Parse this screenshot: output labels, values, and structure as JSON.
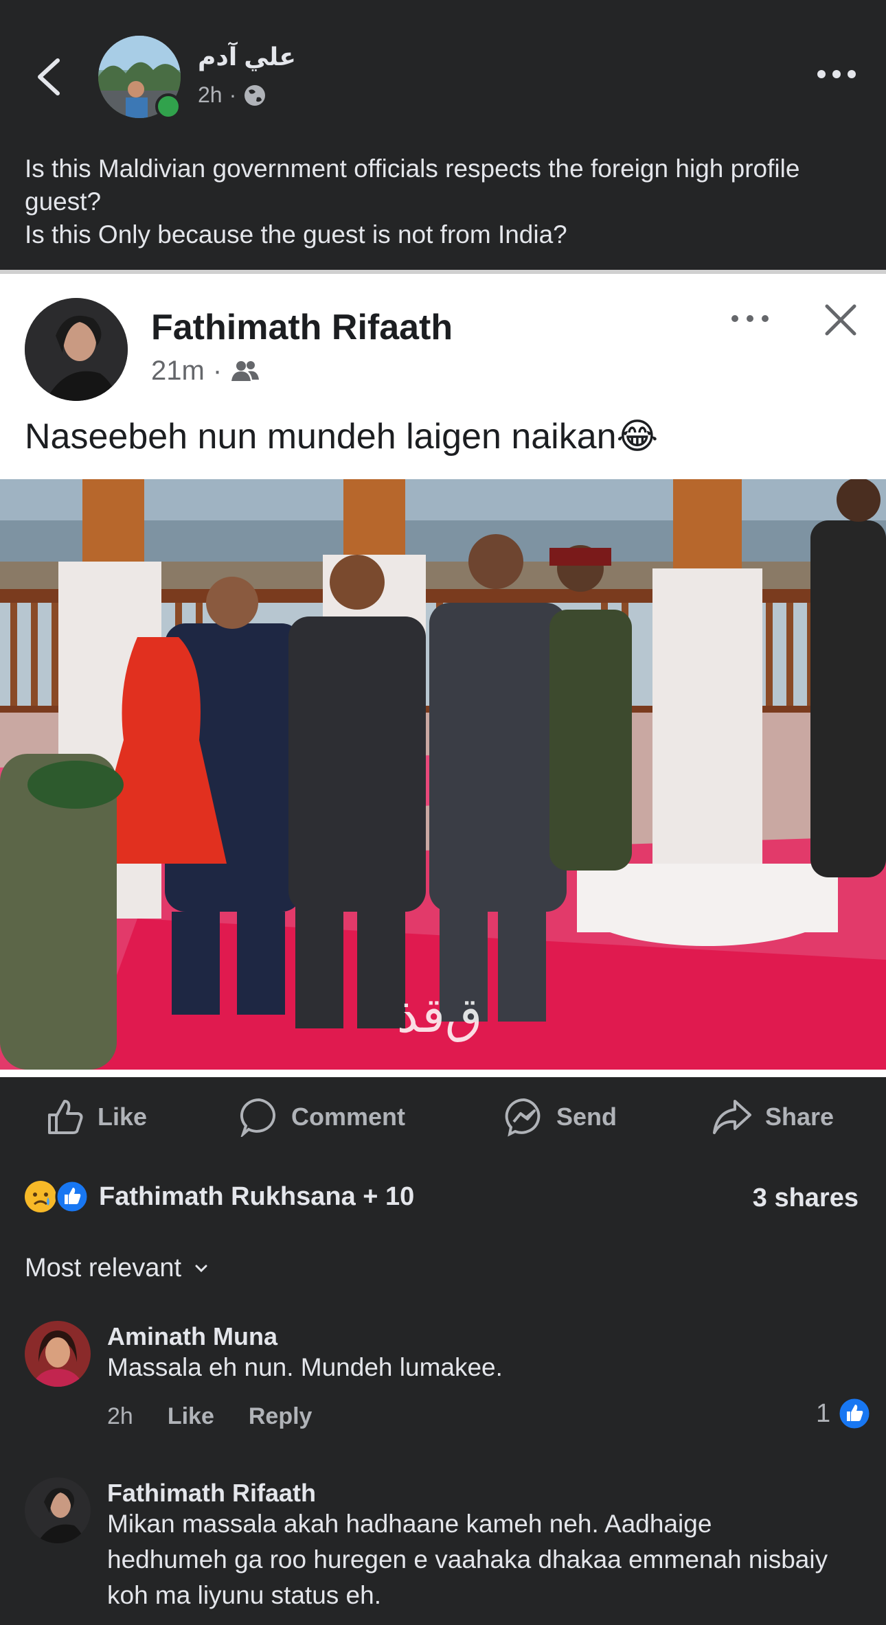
{
  "header": {
    "author": "علي آدم",
    "time": "2h",
    "post_text_line1": "Is this Maldivian government officials respects the foreign high profile guest?",
    "post_text_line2": "Is this Only because the guest is not from India?"
  },
  "shared_post": {
    "author": "Fathimath Rifaath",
    "time": "21m",
    "text": "Naseebeh nun mundeh laigen naikan😂"
  },
  "actions": {
    "like": "Like",
    "comment": "Comment",
    "send": "Send",
    "share": "Share"
  },
  "reactions": {
    "summary": "Fathimath Rukhsana + 10",
    "shares": "3 shares"
  },
  "sort": {
    "label": "Most relevant"
  },
  "comments": [
    {
      "author": "Aminath Muna",
      "text": "Massala eh nun. Mundeh lumakee.",
      "time": "2h",
      "like": "Like",
      "reply": "Reply",
      "like_count": "1"
    },
    {
      "author": "Fathimath Rifaath",
      "text": "Mikan massala akah hadhaane kameh neh. Aadhaige hedhumeh ga roo huregen e vaahaka dhakaa emmenah nisbaiy koh ma liyunu status eh."
    }
  ],
  "colors": {
    "background": "#242526",
    "text_primary": "#e4e6eb",
    "text_secondary": "#b0b3b8",
    "like_blue": "#1877f2",
    "online_green": "#31a24c"
  }
}
